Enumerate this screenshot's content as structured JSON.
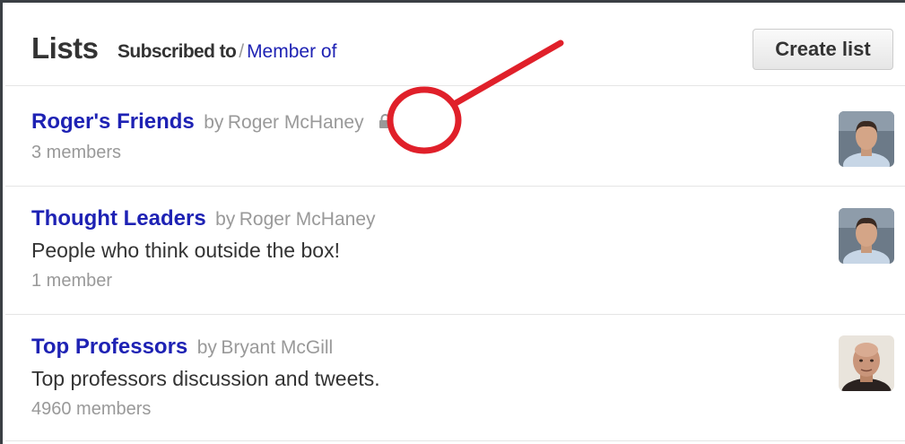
{
  "header": {
    "title": "Lists",
    "tab_subscribed": "Subscribed to",
    "separator": "/",
    "tab_member": "Member of",
    "create_button": "Create list"
  },
  "lists": [
    {
      "name": "Roger's Friends",
      "by": "by",
      "owner": "Roger McHaney",
      "private": true,
      "description": "",
      "members": "3 members",
      "avatar_icon": "user-avatar-roger"
    },
    {
      "name": "Thought Leaders",
      "by": "by",
      "owner": "Roger McHaney",
      "private": false,
      "description": "People who think outside the box!",
      "members": "1 member",
      "avatar_icon": "user-avatar-roger"
    },
    {
      "name": "Top Professors",
      "by": "by",
      "owner": "Bryant McGill",
      "private": false,
      "description": "Top professors discussion and tweets.",
      "members": "4960 members",
      "avatar_icon": "user-avatar-bryant"
    }
  ],
  "colors": {
    "link": "#1e22b4",
    "muted": "#999999",
    "text": "#333333",
    "annotation": "#e0202a"
  }
}
